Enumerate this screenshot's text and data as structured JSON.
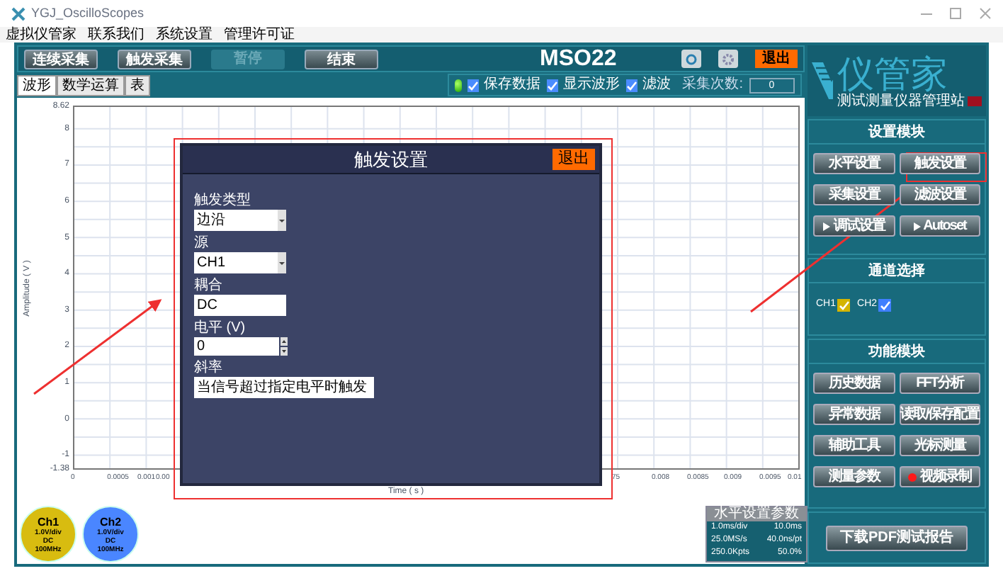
{
  "window": {
    "title": "YGJ_OscilloScopes"
  },
  "menu": [
    "虚拟仪管家",
    "联系我们",
    "系统设置",
    "管理许可证"
  ],
  "toolbar": {
    "buttons": [
      {
        "label": "连续采集",
        "disabled": false
      },
      {
        "label": "触发采集",
        "disabled": false
      },
      {
        "label": "暂停",
        "disabled": true
      },
      {
        "label": "结束",
        "disabled": false
      }
    ],
    "title": "MSO22",
    "exit": "退出"
  },
  "logo": {
    "name": "仪管家",
    "tagline": "测试测量仪器管理站"
  },
  "tabs": [
    {
      "label": "波形",
      "selected": true
    },
    {
      "label": "数学运算",
      "selected": false
    },
    {
      "label": "表",
      "selected": false
    }
  ],
  "options": [
    {
      "label": "保存数据",
      "checked": true
    },
    {
      "label": "显示波形",
      "checked": true
    },
    {
      "label": "滤波",
      "checked": true
    }
  ],
  "count": {
    "label": "采集次数:",
    "value": "0"
  },
  "plot": {
    "ylabel": "Amplitude ( V )",
    "xlabel": "Time ( s )",
    "y_ticks": [
      "8.62",
      "8",
      "7",
      "6",
      "5",
      "4",
      "3",
      "2",
      "1",
      "0",
      "-1",
      "-1.38"
    ],
    "x_ticks": [
      "0",
      "0.0005",
      "0.001",
      "0.00",
      "75",
      "0.008",
      "0.0085",
      "0.009",
      "0.0095",
      "0.01"
    ]
  },
  "dialog": {
    "title": "触发设置",
    "exit": "退出",
    "fields": [
      {
        "label": "触发类型",
        "value": "边沿",
        "kind": "dropdown"
      },
      {
        "label": "源",
        "value": "CH1",
        "kind": "dropdown"
      },
      {
        "label": "耦合",
        "value": "DC",
        "kind": "text"
      },
      {
        "label": "电平 (V)",
        "value": "0",
        "kind": "spinner"
      },
      {
        "label": "斜率",
        "value": "当信号超过指定电平时触发",
        "kind": "wide"
      }
    ]
  },
  "settings": {
    "title": "设置模块",
    "buttons": [
      {
        "label": "水平设置",
        "kind": "plain"
      },
      {
        "label": "触发设置",
        "kind": "plain"
      },
      {
        "label": "采集设置",
        "kind": "plain"
      },
      {
        "label": "滤波设置",
        "kind": "plain"
      },
      {
        "label": "调试设置",
        "kind": "play"
      },
      {
        "label": "Autoset",
        "kind": "play"
      }
    ]
  },
  "channel_select": {
    "title": "通道选择",
    "channels": [
      {
        "label": "CH1",
        "checked": true,
        "color": "#d4b400"
      },
      {
        "label": "CH2",
        "checked": true,
        "color": "#3f7fff"
      }
    ]
  },
  "functions": {
    "title": "功能模块",
    "buttons": [
      {
        "label": "历史数据",
        "kind": "plain"
      },
      {
        "label": "FFT分析",
        "kind": "plain"
      },
      {
        "label": "异常数据",
        "kind": "plain"
      },
      {
        "label": "读取/保存配置",
        "kind": "plain"
      },
      {
        "label": "辅助工具",
        "kind": "plain"
      },
      {
        "label": "光标测量",
        "kind": "plain"
      },
      {
        "label": "测量参数",
        "kind": "plain"
      },
      {
        "label": "视频录制",
        "kind": "record"
      }
    ]
  },
  "report_button": "下载PDF测试报告",
  "channel_badges": [
    {
      "name": "Ch1",
      "scale": "1.0V/div",
      "coupling": "DC",
      "bandwidth": "100MHz",
      "color": "#d8bc10"
    },
    {
      "name": "Ch2",
      "scale": "1.0V/div",
      "coupling": "DC",
      "bandwidth": "100MHz",
      "color": "#4a86ff"
    }
  ],
  "horizontal": {
    "title": "水平设置参数",
    "rows": [
      [
        "1.0ms/div",
        "10.0ms"
      ],
      [
        "25.0MS/s",
        "40.0ns/pt"
      ],
      [
        "250.0Kpts",
        "50.0%"
      ]
    ]
  }
}
